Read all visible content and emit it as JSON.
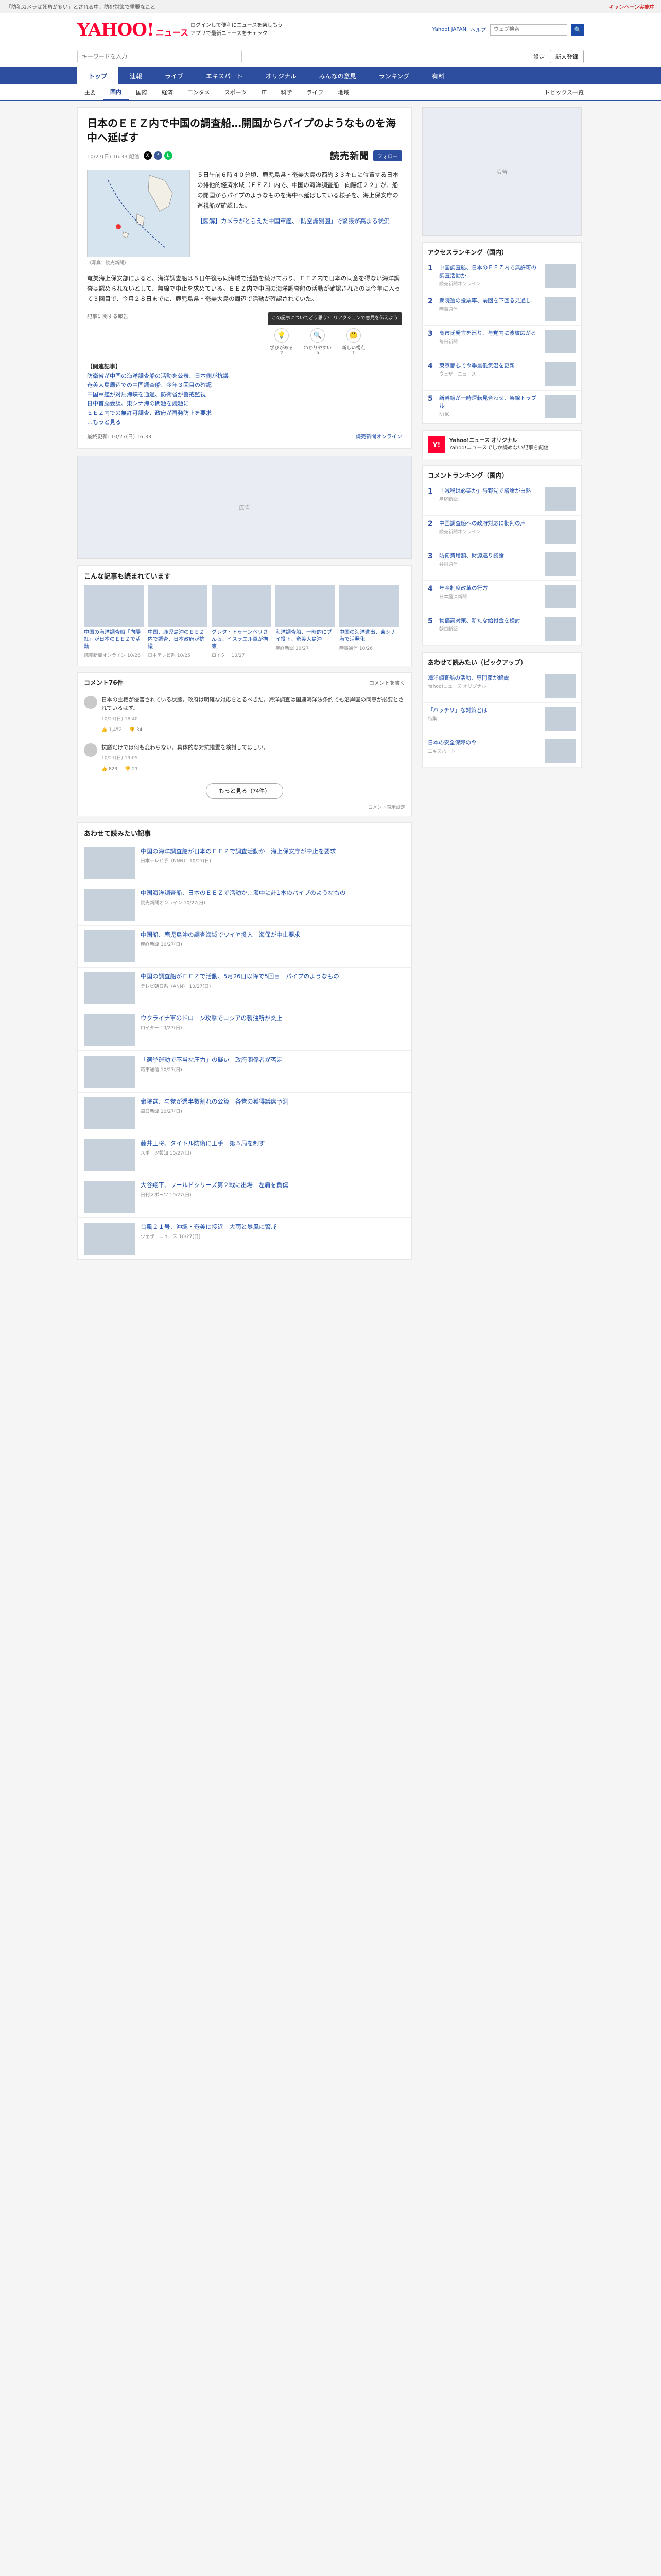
{
  "topbar": {
    "message": "「防犯カメラは死角が多い」とされる中、防犯対策で重要なこと",
    "promo": "キャンペーン実施中"
  },
  "header": {
    "logo_main": "YAHOO!",
    "logo_sub": "ニュース",
    "mid_line1": "ログインして便利にニュースを楽しもう",
    "mid_line2": "アプリで最新ニュースをチェック",
    "link_yahoo": "Yahoo! JAPAN",
    "link_help": "ヘルプ",
    "search_placeholder": "ウェブ検索",
    "search_btn": "🔍"
  },
  "search_row": {
    "placeholder": "キーワードを入力",
    "pref": "設定",
    "login": "新人登録"
  },
  "mainnav": [
    "トップ",
    "速報",
    "ライブ",
    "エキスパート",
    "オリジナル",
    "みんなの意見",
    "ランキング",
    "有料"
  ],
  "subnav": {
    "items": [
      "主要",
      "国内",
      "国際",
      "経済",
      "エンタメ",
      "スポーツ",
      "IT",
      "科学",
      "ライフ",
      "地域"
    ],
    "topics": "トピックス一覧"
  },
  "article": {
    "title": "日本のＥＥＺ内で中国の調査船…開国からパイプのようなものを海中へ延ばす",
    "date": "10/27(日) 16:33 配信",
    "publisher": "読売新聞",
    "follow": "フォロー",
    "map_caption": "（写真：読売新聞）",
    "lead": "５日午前６時４０分頃、鹿児島県・奄美大島の西約３３キロに位置する日本の排他的経済水域（ＥＥＺ）内で、中国の海洋調査船「向陽紅２２」が、船の開国からパイプのようなものを海中へ延ばしている様子を、海上保安庁の巡視船が確認した。",
    "lead_hl": "【図解】カメラがとらえた中国軍艦、「防空識別圏」で緊張が高まる状況",
    "body": "奄美海上保安部によると、海洋調査船は５日午後も同海域で活動を続けており、ＥＥＺ内で日本の同意を得ない海洋調査は認められないとして、無線で中止を求めている。ＥＥＺ内で中国の海洋調査船の活動が確認されたのは今年に入って３回目で、今月２８日までに、鹿児島県・奄美大島の周辺で活動が確認されていた。",
    "tooltip": "この記事についてどう思う？ リアクションで意見を伝えよう",
    "report": "記事に関する報告",
    "reactions": [
      {
        "icon": "💡",
        "label": "学びがある",
        "count": "2"
      },
      {
        "icon": "🔍",
        "label": "わかりやすい",
        "count": "5"
      },
      {
        "icon": "🤔",
        "label": "新しい視点",
        "count": "1"
      }
    ],
    "related_header": "【関連記事】",
    "related_links": [
      "防衛省が中国の海洋調査船の活動を公表、日本側が抗議",
      "奄美大島周辺での中国調査船、今年３回目の確認",
      "中国軍艦が対馬海峡を通過、防衛省が警戒監視",
      "日中首脳会談、東シナ海の問題を議題に",
      "ＥＥＺ内での無許可調査、政府が再発防止を要求"
    ],
    "more": "…もっと見る",
    "foot_left": "最終更新: 10/27(日) 16:33",
    "foot_right": "読売新聞オンライン"
  },
  "ad_label": "広告",
  "read_also": {
    "title": "こんな記事も読まれています",
    "items": [
      {
        "title": "中国の海洋調査船「向陽紅」が日本のＥＥＺで活動",
        "meta": "読売新聞オンライン 10/26"
      },
      {
        "title": "中国、鹿児島沖のＥＥＺ内で調査、日本政府が抗議",
        "meta": "日本テレビ系 10/25"
      },
      {
        "title": "グレタ・トゥーンベリさんら、イスラエル軍が拘束",
        "meta": "ロイター 10/27"
      },
      {
        "title": "海洋調査船、一時的にブイ投下、奄美大島沖",
        "meta": "産経新聞 10/27"
      },
      {
        "title": "中国の海洋進出、東シナ海で活発化",
        "meta": "時事通信 10/26"
      }
    ]
  },
  "comments": {
    "title": "コメント76件",
    "note": "コメントを書く",
    "items": [
      {
        "text": "日本の主権が侵害されている状態。政府は明確な対応をとるべきだ。海洋調査は国連海洋法条約でも沿岸国の同意が必要とされているはず。",
        "meta": "10/27(日) 18:40",
        "up": "1,452",
        "down": "34"
      },
      {
        "text": "抗議だけでは何も変わらない。具体的な対抗措置を検討してほしい。",
        "meta": "10/27(日) 19:05",
        "up": "823",
        "down": "21"
      }
    ],
    "more": "もっと見る（74件）",
    "footer": "コメント表示設定"
  },
  "recommended": {
    "title": "あわせて読みたい記事",
    "items": [
      {
        "title": "中国の海洋調査船が日本のＥＥＺで調査活動か　海上保安庁が中止を要求",
        "meta": "日本テレビ系（NNN） 10/27(日)"
      },
      {
        "title": "中国海洋調査船、日本のＥＥＺで活動か…海中に計1本のパイプのようなもの",
        "meta": "読売新聞オンライン 10/27(日)"
      },
      {
        "title": "中国船、鹿児島沖の調査海域でワイヤ投入　海保が中止要求",
        "meta": "産経新聞 10/27(日)"
      },
      {
        "title": "中国の調査船がＥＥＺで活動、5月26日以降で5回目　パイプのようなもの",
        "meta": "テレビ朝日系（ANN） 10/27(日)"
      },
      {
        "title": "ウクライナ軍のドローン攻撃でロシアの製油所が炎上",
        "meta": "ロイター 10/27(日)"
      },
      {
        "title": "「選挙運動で不当な圧力」の疑い　政府関係者が否定",
        "meta": "時事通信 10/27(日)"
      },
      {
        "title": "衆院選、与党が過半数割れの公算　各党の獲得議席予測",
        "meta": "毎日新聞 10/27(日)"
      },
      {
        "title": "藤井王将、タイトル防衛に王手　第５局を制す",
        "meta": "スポーツ報知 10/27(日)"
      },
      {
        "title": "大谷翔平、ワールドシリーズ第２戦に出場　左肩を負傷",
        "meta": "日刊スポーツ 10/27(日)"
      },
      {
        "title": "台風２１号、沖縄・奄美に接近　大雨と暴風に警戒",
        "meta": "ウェザーニュース 10/27(日)"
      }
    ]
  },
  "sidebar": {
    "access_title": "アクセスランキング（国内）",
    "access_items": [
      {
        "title": "中国調査船、日本のＥＥＺ内で無許可の調査活動か",
        "meta": "読売新聞オンライン"
      },
      {
        "title": "衆院選の投票率、前回を下回る見通し",
        "meta": "時事通信"
      },
      {
        "title": "高市氏発言を巡り、与党内に波紋広がる",
        "meta": "毎日新聞"
      },
      {
        "title": "東京都心で今季最低気温を更新",
        "meta": "ウェザーニュース"
      },
      {
        "title": "新幹線が一時運転見合わせ、架線トラブル",
        "meta": "NHK"
      }
    ],
    "official_name": "Yahoo!ニュース オリジナル",
    "official_desc": "Yahoo!ニュースでしか読めない記事を配信",
    "comments_title": "コメントランキング（国内）",
    "comments_items": [
      {
        "title": "「減税は必要か」与野党で議論が白熱",
        "meta": "産経新聞"
      },
      {
        "title": "中国調査船への政府対応に批判の声",
        "meta": "読売新聞オンライン"
      },
      {
        "title": "防衛費増額、財源巡り議論",
        "meta": "共同通信"
      },
      {
        "title": "年金制度改革の行方",
        "meta": "日本経済新聞"
      },
      {
        "title": "物価高対策、新たな給付金を検討",
        "meta": "朝日新聞"
      }
    ],
    "ad_label": "広告",
    "pick_title": "あわせて読みたい（ピックアップ）",
    "pick_items": [
      {
        "title": "海洋調査船の活動、専門家が解説",
        "meta": "Yahoo!ニュース オリジナル"
      },
      {
        "title": "「バッチリ」な対策とは",
        "meta": "特集"
      },
      {
        "title": "日本の安全保障の今",
        "meta": "エキスパート"
      }
    ]
  }
}
